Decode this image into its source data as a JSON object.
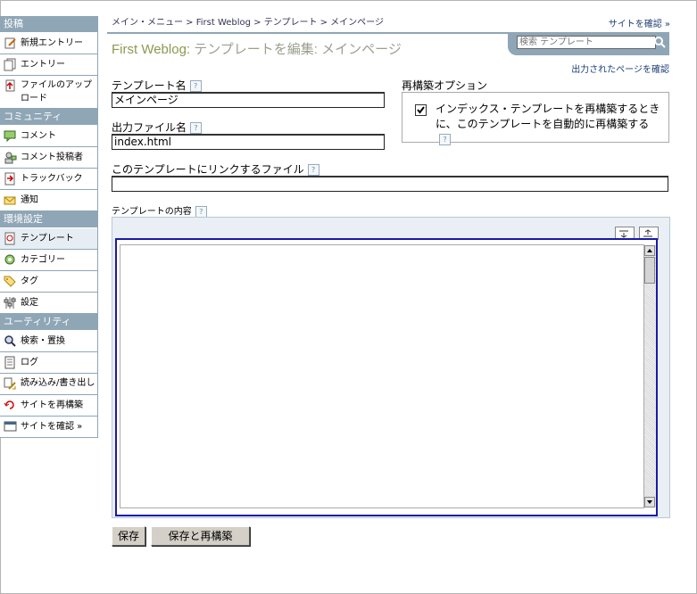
{
  "sidebar": {
    "sections": [
      {
        "title": "投稿",
        "items": [
          {
            "label": "新規エントリー",
            "icon": "new-entry-icon"
          },
          {
            "label": "エントリー",
            "icon": "entries-icon"
          },
          {
            "label": "ファイルのアップロード",
            "icon": "upload-file-icon"
          }
        ]
      },
      {
        "title": "コミュニティ",
        "items": [
          {
            "label": "コメント",
            "icon": "comment-icon"
          },
          {
            "label": "コメント投稿者",
            "icon": "commenter-icon"
          },
          {
            "label": "トラックバック",
            "icon": "trackback-icon"
          },
          {
            "label": "通知",
            "icon": "notification-icon"
          }
        ]
      },
      {
        "title": "環境設定",
        "items": [
          {
            "label": "テンプレート",
            "icon": "template-icon"
          },
          {
            "label": "カテゴリー",
            "icon": "category-icon"
          },
          {
            "label": "タグ",
            "icon": "tag-icon"
          },
          {
            "label": "設定",
            "icon": "settings-icon"
          }
        ]
      },
      {
        "title": "ユーティリティ",
        "items": [
          {
            "label": "検索・置換",
            "icon": "search-replace-icon"
          },
          {
            "label": "ログ",
            "icon": "log-icon"
          },
          {
            "label": "読み込み/書き出し",
            "icon": "import-export-icon"
          },
          {
            "label": "サイトを再構築",
            "icon": "rebuild-site-icon"
          },
          {
            "label": "サイトを確認 »",
            "icon": "view-site-icon"
          }
        ]
      }
    ]
  },
  "breadcrumb": "メイン・メニュー > First Weblog > テンプレート > メインページ",
  "top_link": "サイトを確認 »",
  "title": {
    "blog": "First Weblog:",
    "rest": " テンプレートを編集: メインページ"
  },
  "search": {
    "placeholder": "検索 テンプレート"
  },
  "confirm_output_link": "出力されたページを確認",
  "template_name": {
    "label": "テンプレート名",
    "value": "メインページ"
  },
  "output_file": {
    "label": "出力ファイル名",
    "value": "index.html"
  },
  "linked_file": {
    "label": "このテンプレートにリンクするファイル",
    "value": ""
  },
  "rebuild": {
    "label": "再構築オプション",
    "option": "インデックス・テンプレートを再構築するときに、このテンプレートを自動的に再構築する",
    "checked": true
  },
  "content": {
    "label": "テンプレートの内容"
  },
  "help_glyph": "?",
  "buttons": {
    "save": "保存",
    "save_rebuild": "保存と再構築"
  }
}
